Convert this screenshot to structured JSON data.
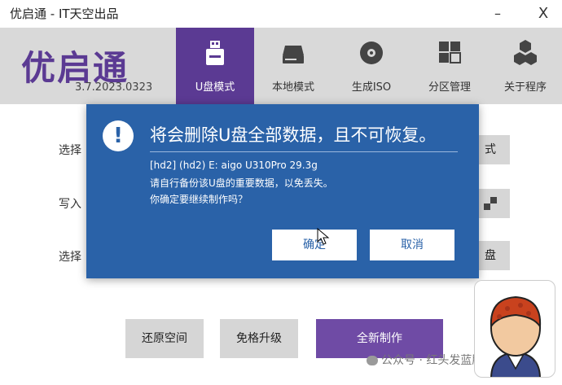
{
  "window": {
    "title": "优启通 - IT天空出品",
    "minimize_glyph": "–",
    "close_glyph": "X"
  },
  "header": {
    "logo": "优启通",
    "version": "3.7.2023.0323",
    "tabs": [
      {
        "label": "U盘模式",
        "icon": "usb-drive-icon",
        "active": true
      },
      {
        "label": "本地模式",
        "icon": "hard-disk-icon",
        "active": false
      },
      {
        "label": "生成ISO",
        "icon": "disc-icon",
        "active": false
      },
      {
        "label": "分区管理",
        "icon": "partition-grid-icon",
        "active": false
      },
      {
        "label": "关于程序",
        "icon": "hexagons-icon",
        "active": false
      }
    ]
  },
  "main": {
    "labels": [
      "选择",
      "写入",
      "选择"
    ],
    "side_buttons": [
      "式",
      "",
      "盘"
    ],
    "bottom_buttons": [
      "还原空间",
      "免格升级",
      "全新制作"
    ]
  },
  "dialog": {
    "icon": "warning-icon",
    "title": "将会删除U盘全部数据，且不可恢复。",
    "lines": [
      "[hd2] (hd2) E: aigo U310Pro 29.3g",
      "请自行备份该U盘的重要数据，以免丢失。",
      "你确定要继续制作吗？"
    ],
    "confirm_label": "确定",
    "cancel_label": "取消"
  },
  "watermark": {
    "text": "公众号 · 红头发蓝胖子"
  },
  "colors": {
    "brand_purple": "#5b3a93",
    "primary_button": "#6f4ba5",
    "dialog_blue": "#2a62a8",
    "header_gray": "#d9d9d9"
  }
}
